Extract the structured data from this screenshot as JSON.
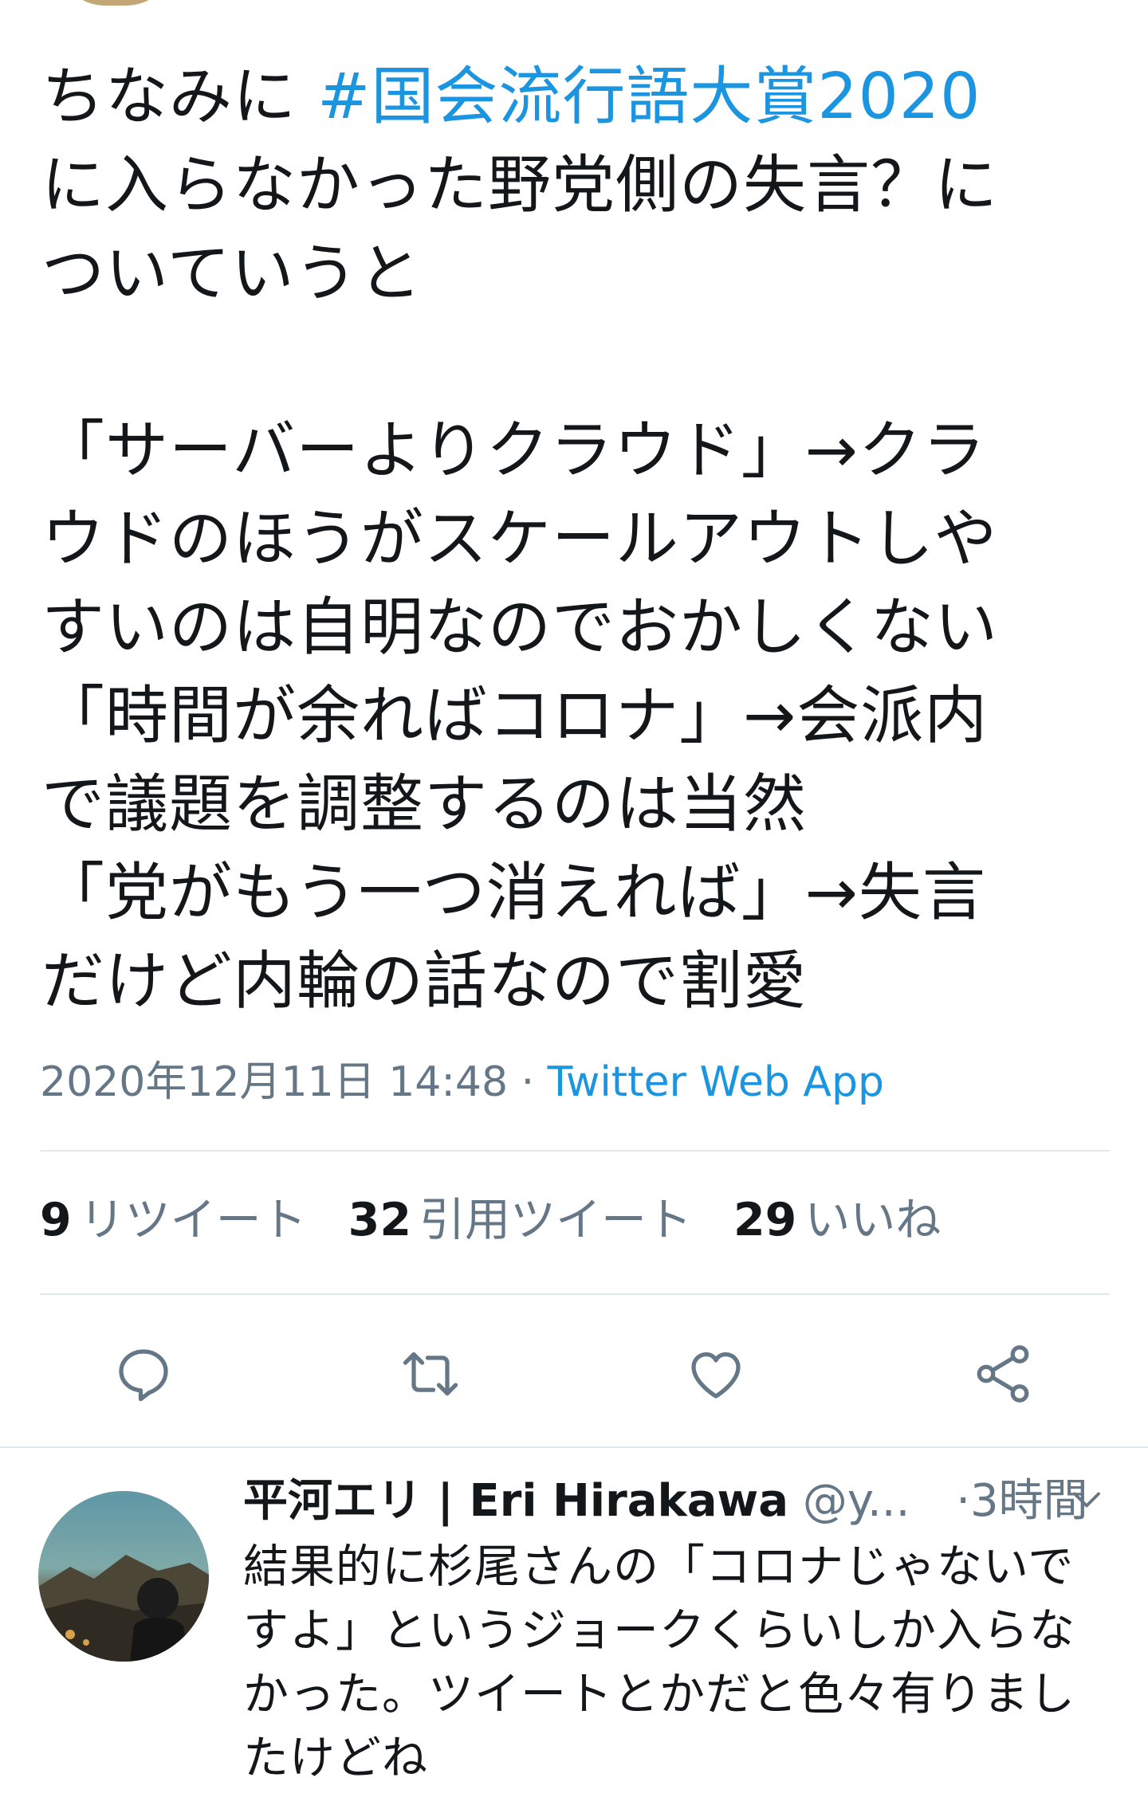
{
  "tweet": {
    "text_prefix": "ちなみに ",
    "hashtag": "#国会流行語大賞2020",
    "text_lines_after_hashtag": [
      "に入らなかった野党側の失言？に",
      "ついていうと"
    ],
    "text_block_lines": [
      "「サーバーよりクラウド」→クラ",
      "ウドのほうがスケールアウトしや",
      "すいのは自明なのでおかしくない",
      "「時間が余ればコロナ」→会派内",
      "で議題を調整するのは当然",
      "「党がもう一つ消えれば」→失言",
      "だけど内輪の話なので割愛"
    ],
    "timestamp": "2020年12月11日 14:48",
    "separator": " · ",
    "source": "Twitter Web App"
  },
  "stats": {
    "retweets_count": "9",
    "retweets_label": "リツイート",
    "quotes_count": "32",
    "quotes_label": "引用ツイート",
    "likes_count": "29",
    "likes_label": "いいね"
  },
  "actions": {
    "reply_icon": "reply-icon",
    "retweet_icon": "retweet-icon",
    "like_icon": "heart-icon",
    "share_icon": "share-icon"
  },
  "reply": {
    "display_name": "平河エリ | Eri Hirakawa",
    "handle": "@y...",
    "time": "·3時間",
    "text_lines": [
      "結果的に杉尾さんの「コロナじゃないで",
      "すよ」というジョークくらいしか入らな",
      "かった。ツイートとかだと色々有りまし",
      "たけどね"
    ]
  },
  "colors": {
    "link": "#1b95e0",
    "secondary_text": "#657786",
    "primary_text": "#14171a",
    "divider": "#e1e8ed"
  }
}
